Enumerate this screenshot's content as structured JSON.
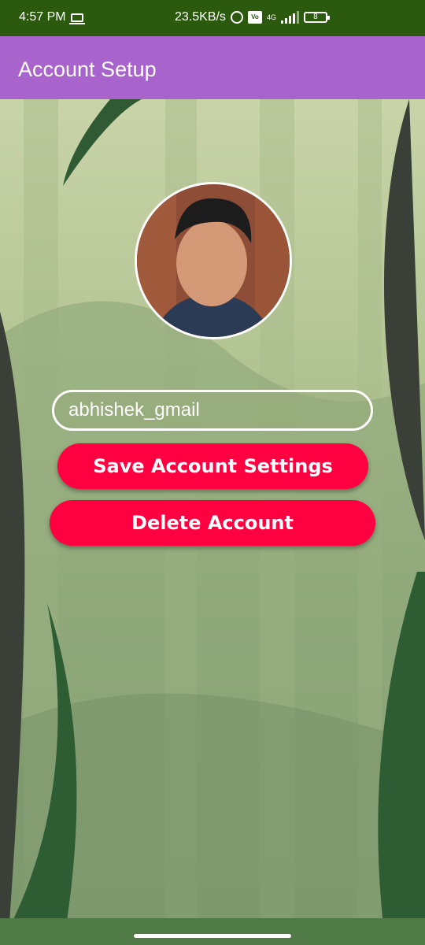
{
  "status_bar": {
    "time": "4:57 PM",
    "net_speed": "23.5KB/s",
    "network_type": "4G",
    "volte_label": "Vo LTE",
    "battery_level": "8",
    "icons": [
      "laptop-icon",
      "alarm-icon",
      "volte-icon",
      "signal-icon",
      "battery-icon"
    ]
  },
  "app_bar": {
    "title": "Account Setup",
    "color": "#a864cc"
  },
  "profile": {
    "username_value": "abhishek_gmail"
  },
  "buttons": {
    "save_label": "Save Account Settings",
    "delete_label": "Delete Account",
    "color": "#ff0040"
  }
}
